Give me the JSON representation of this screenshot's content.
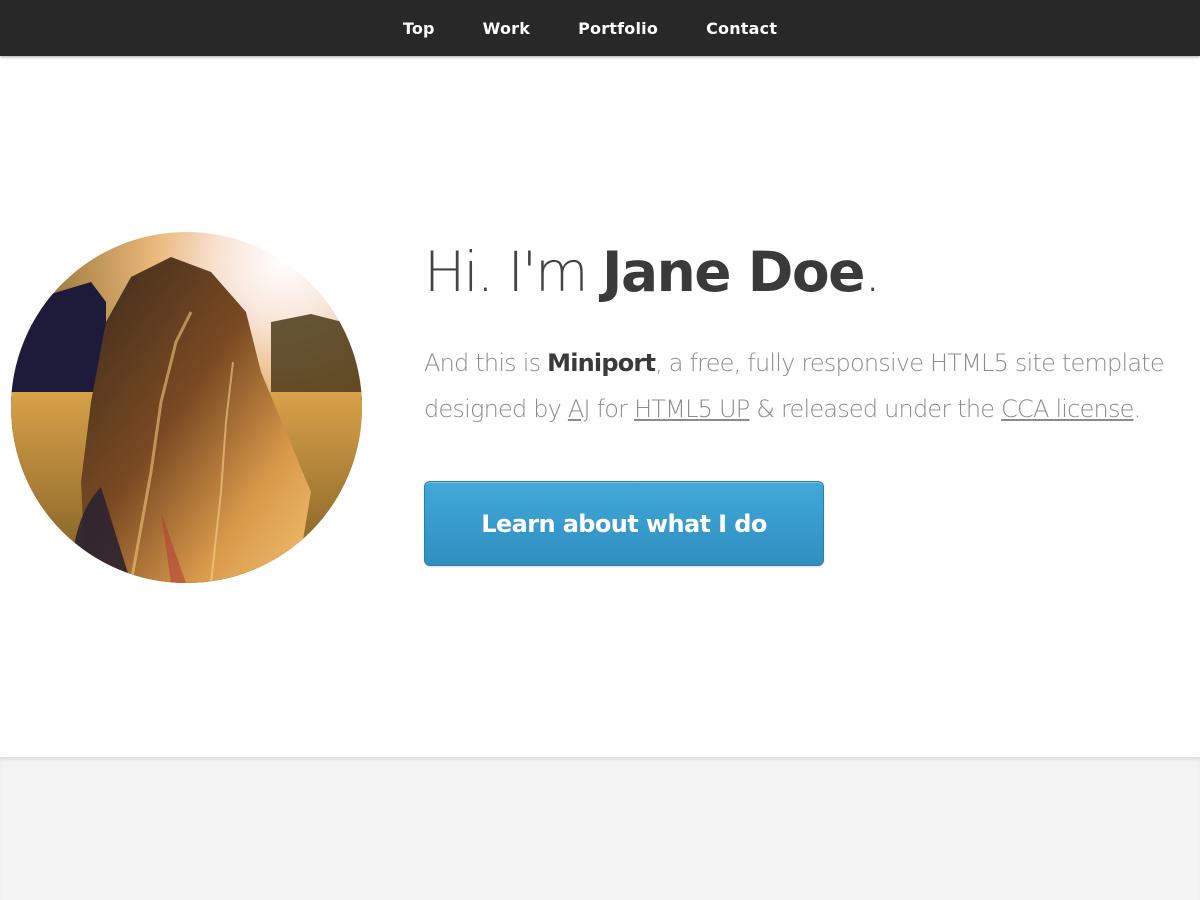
{
  "nav": {
    "items": [
      "Top",
      "Work",
      "Portfolio",
      "Contact"
    ]
  },
  "hero": {
    "headline_prefix": "Hi. I'm ",
    "headline_name": "Jane Doe",
    "headline_suffix": ".",
    "blurb_line1_prefix": "And this is ",
    "blurb_product": "Miniport",
    "blurb_line1_suffix": ", a free, fully responsive HTML5 site template",
    "blurb_line2_prefix": "designed by ",
    "blurb_author_link": "AJ",
    "blurb_for": " for ",
    "blurb_site_link": "HTML5 UP",
    "blurb_released": " & released under the ",
    "blurb_license_link": "CCA license",
    "blurb_end": ".",
    "cta_label": "Learn about what I do"
  },
  "colors": {
    "navbar": "#282828",
    "button": "#3a9dcf",
    "text_dark": "#3a3a3a",
    "text_light": "#8c8c8c"
  }
}
